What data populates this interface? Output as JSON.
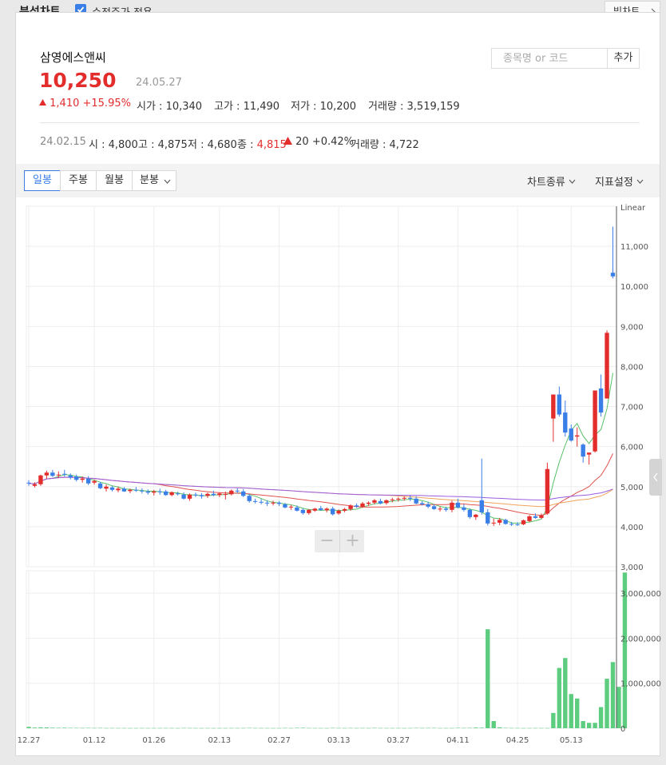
{
  "header": {
    "title": "분석차트",
    "adjusted_label": "수정주가 적용",
    "big_chart_label": "빅차트"
  },
  "stock": {
    "name": "삼영에스앤씨",
    "price": "10,250",
    "date": "24.05.27",
    "change": "1,410",
    "change_pct": "+15.95%",
    "open_label": "시가 : ",
    "open": "10,340",
    "high_label": "고가 : ",
    "high": "11,490",
    "low_label": "저가 : ",
    "low": "10,200",
    "volume_label": "거래량 : ",
    "volume": "3,519,159"
  },
  "search": {
    "placeholder": "종목명 or 코드",
    "add_label": "추가"
  },
  "hover": {
    "date": "24.02.15",
    "open_label": "시 : ",
    "open": "4,800",
    "high_label": "고 : ",
    "high": "4,875",
    "low_label": "저 : ",
    "low": "4,680",
    "close_label": "종 : ",
    "close": "4,815",
    "change": "20",
    "change_pct": "+0.42%",
    "volume_label": "거래량 : ",
    "volume": "4,722"
  },
  "toolbar": {
    "tabs": [
      "일봉",
      "주봉",
      "월봉",
      "분봉"
    ],
    "chart_type": "차트종류",
    "indicator": "지표설정"
  },
  "colors": {
    "up": "#e32d2d",
    "down": "#3a7ee8",
    "volume": "#5ccc7e",
    "ma5": "#58c168",
    "ma20": "#e0524d",
    "ma60": "#f0a35a",
    "ma120": "#9b5ce0"
  },
  "chart_data": {
    "type": "candlestick",
    "scale_label": "Linear",
    "price_ticks": [
      "3,000",
      "4,000",
      "5,000",
      "6,000",
      "7,000",
      "8,000",
      "9,000",
      "10,000",
      "11,000"
    ],
    "price_tick_values": [
      3000,
      4000,
      5000,
      6000,
      7000,
      8000,
      9000,
      10000,
      11000
    ],
    "price_range": [
      3000,
      12000
    ],
    "volume_ticks": [
      "0",
      "1,000,000",
      "2,000,000",
      "3,000,000"
    ],
    "volume_tick_values": [
      0,
      1000000,
      2000000,
      3000000
    ],
    "volume_range": [
      0,
      3500000
    ],
    "x_tick_labels": [
      "12.27",
      "01.12",
      "01.26",
      "02.13",
      "02.27",
      "03.13",
      "03.27",
      "04.11",
      "04.25",
      "05.13"
    ],
    "x_tick_index": [
      0,
      11,
      21,
      32,
      42,
      52,
      62,
      72,
      82,
      91
    ],
    "grid": true,
    "candles": [
      {
        "o": 5100,
        "h": 5160,
        "l": 5020,
        "c": 5080
      },
      {
        "o": 5020,
        "h": 5110,
        "l": 4980,
        "c": 5060
      },
      {
        "o": 5060,
        "h": 5300,
        "l": 5020,
        "c": 5280
      },
      {
        "o": 5280,
        "h": 5400,
        "l": 5200,
        "c": 5350
      },
      {
        "o": 5350,
        "h": 5420,
        "l": 5240,
        "c": 5270
      },
      {
        "o": 5280,
        "h": 5380,
        "l": 5220,
        "c": 5300
      },
      {
        "o": 5320,
        "h": 5420,
        "l": 5250,
        "c": 5300
      },
      {
        "o": 5280,
        "h": 5330,
        "l": 5180,
        "c": 5230
      },
      {
        "o": 5250,
        "h": 5300,
        "l": 5130,
        "c": 5170
      },
      {
        "o": 5170,
        "h": 5250,
        "l": 5100,
        "c": 5200
      },
      {
        "o": 5200,
        "h": 5260,
        "l": 5040,
        "c": 5080
      },
      {
        "o": 5100,
        "h": 5180,
        "l": 5050,
        "c": 5140
      },
      {
        "o": 5080,
        "h": 5120,
        "l": 4940,
        "c": 4960
      },
      {
        "o": 4950,
        "h": 5050,
        "l": 4880,
        "c": 5000
      },
      {
        "o": 4980,
        "h": 5020,
        "l": 4880,
        "c": 4920
      },
      {
        "o": 4910,
        "h": 5000,
        "l": 4860,
        "c": 4950
      },
      {
        "o": 4950,
        "h": 4990,
        "l": 4870,
        "c": 4880
      },
      {
        "o": 4890,
        "h": 4950,
        "l": 4840,
        "c": 4920
      },
      {
        "o": 4920,
        "h": 4990,
        "l": 4870,
        "c": 4900
      },
      {
        "o": 4900,
        "h": 4960,
        "l": 4830,
        "c": 4880
      },
      {
        "o": 4880,
        "h": 4930,
        "l": 4800,
        "c": 4850
      },
      {
        "o": 4850,
        "h": 4920,
        "l": 4780,
        "c": 4880
      },
      {
        "o": 4880,
        "h": 4950,
        "l": 4800,
        "c": 4870
      },
      {
        "o": 4880,
        "h": 4920,
        "l": 4770,
        "c": 4790
      },
      {
        "o": 4790,
        "h": 4880,
        "l": 4760,
        "c": 4860
      },
      {
        "o": 4830,
        "h": 4870,
        "l": 4780,
        "c": 4820
      },
      {
        "o": 4800,
        "h": 4860,
        "l": 4680,
        "c": 4700
      },
      {
        "o": 4700,
        "h": 4830,
        "l": 4650,
        "c": 4800
      },
      {
        "o": 4800,
        "h": 4850,
        "l": 4740,
        "c": 4790
      },
      {
        "o": 4790,
        "h": 4840,
        "l": 4700,
        "c": 4760
      },
      {
        "o": 4770,
        "h": 4850,
        "l": 4720,
        "c": 4820
      },
      {
        "o": 4820,
        "h": 4900,
        "l": 4760,
        "c": 4790
      },
      {
        "o": 4790,
        "h": 4850,
        "l": 4740,
        "c": 4830
      },
      {
        "o": 4800,
        "h": 4875,
        "l": 4680,
        "c": 4815
      },
      {
        "o": 4810,
        "h": 4930,
        "l": 4780,
        "c": 4900
      },
      {
        "o": 4900,
        "h": 4960,
        "l": 4840,
        "c": 4880
      },
      {
        "o": 4880,
        "h": 4940,
        "l": 4740,
        "c": 4770
      },
      {
        "o": 4770,
        "h": 4820,
        "l": 4600,
        "c": 4640
      },
      {
        "o": 4640,
        "h": 4700,
        "l": 4580,
        "c": 4620
      },
      {
        "o": 4620,
        "h": 4690,
        "l": 4560,
        "c": 4600
      },
      {
        "o": 4600,
        "h": 4660,
        "l": 4520,
        "c": 4580
      },
      {
        "o": 4580,
        "h": 4650,
        "l": 4530,
        "c": 4600
      },
      {
        "o": 4600,
        "h": 4640,
        "l": 4520,
        "c": 4570
      },
      {
        "o": 4560,
        "h": 4590,
        "l": 4460,
        "c": 4480
      },
      {
        "o": 4480,
        "h": 4540,
        "l": 4420,
        "c": 4500
      },
      {
        "o": 4480,
        "h": 4530,
        "l": 4380,
        "c": 4400
      },
      {
        "o": 4420,
        "h": 4460,
        "l": 4300,
        "c": 4340
      },
      {
        "o": 4340,
        "h": 4440,
        "l": 4300,
        "c": 4420
      },
      {
        "o": 4400,
        "h": 4470,
        "l": 4370,
        "c": 4450
      },
      {
        "o": 4460,
        "h": 4520,
        "l": 4400,
        "c": 4420
      },
      {
        "o": 4410,
        "h": 4480,
        "l": 4360,
        "c": 4450
      },
      {
        "o": 4450,
        "h": 4500,
        "l": 4280,
        "c": 4310
      },
      {
        "o": 4330,
        "h": 4430,
        "l": 4300,
        "c": 4400
      },
      {
        "o": 4400,
        "h": 4470,
        "l": 4360,
        "c": 4440
      },
      {
        "o": 4440,
        "h": 4560,
        "l": 4400,
        "c": 4530
      },
      {
        "o": 4530,
        "h": 4580,
        "l": 4470,
        "c": 4500
      },
      {
        "o": 4500,
        "h": 4620,
        "l": 4470,
        "c": 4580
      },
      {
        "o": 4570,
        "h": 4630,
        "l": 4520,
        "c": 4600
      },
      {
        "o": 4600,
        "h": 4690,
        "l": 4560,
        "c": 4660
      },
      {
        "o": 4640,
        "h": 4700,
        "l": 4560,
        "c": 4580
      },
      {
        "o": 4590,
        "h": 4680,
        "l": 4550,
        "c": 4660
      },
      {
        "o": 4660,
        "h": 4720,
        "l": 4610,
        "c": 4680
      },
      {
        "o": 4680,
        "h": 4740,
        "l": 4630,
        "c": 4700
      },
      {
        "o": 4700,
        "h": 4760,
        "l": 4650,
        "c": 4720
      },
      {
        "o": 4720,
        "h": 4780,
        "l": 4640,
        "c": 4700
      },
      {
        "o": 4700,
        "h": 4760,
        "l": 4560,
        "c": 4580
      },
      {
        "o": 4590,
        "h": 4640,
        "l": 4530,
        "c": 4560
      },
      {
        "o": 4560,
        "h": 4620,
        "l": 4460,
        "c": 4500
      },
      {
        "o": 4510,
        "h": 4560,
        "l": 4420,
        "c": 4440
      },
      {
        "o": 4440,
        "h": 4500,
        "l": 4380,
        "c": 4450
      },
      {
        "o": 4450,
        "h": 4500,
        "l": 4380,
        "c": 4420
      },
      {
        "o": 4420,
        "h": 4650,
        "l": 4360,
        "c": 4600
      },
      {
        "o": 4600,
        "h": 4700,
        "l": 4460,
        "c": 4480
      },
      {
        "o": 4480,
        "h": 4560,
        "l": 4380,
        "c": 4420
      },
      {
        "o": 4420,
        "h": 4460,
        "l": 4200,
        "c": 4240
      },
      {
        "o": 4240,
        "h": 4320,
        "l": 4170,
        "c": 4300
      },
      {
        "o": 4660,
        "h": 5700,
        "l": 4300,
        "c": 4360
      },
      {
        "o": 4360,
        "h": 4440,
        "l": 4030,
        "c": 4080
      },
      {
        "o": 4080,
        "h": 4200,
        "l": 4020,
        "c": 4100
      },
      {
        "o": 4100,
        "h": 4220,
        "l": 4040,
        "c": 4170
      },
      {
        "o": 4170,
        "h": 4200,
        "l": 4050,
        "c": 4070
      },
      {
        "o": 4070,
        "h": 4120,
        "l": 4020,
        "c": 4060
      },
      {
        "o": 4060,
        "h": 4110,
        "l": 4020,
        "c": 4040
      },
      {
        "o": 4060,
        "h": 4180,
        "l": 4040,
        "c": 4160
      },
      {
        "o": 4140,
        "h": 4290,
        "l": 4110,
        "c": 4260
      },
      {
        "o": 4260,
        "h": 4330,
        "l": 4200,
        "c": 4220
      },
      {
        "o": 4220,
        "h": 4330,
        "l": 4200,
        "c": 4280
      },
      {
        "o": 4330,
        "h": 5600,
        "l": 4300,
        "c": 5440
      },
      {
        "o": 6700,
        "h": 7300,
        "l": 6120,
        "c": 7300
      },
      {
        "o": 7300,
        "h": 7500,
        "l": 6750,
        "c": 6800
      },
      {
        "o": 6850,
        "h": 7150,
        "l": 6250,
        "c": 6350
      },
      {
        "o": 6450,
        "h": 6550,
        "l": 6120,
        "c": 6150
      },
      {
        "o": 6250,
        "h": 6480,
        "l": 6000,
        "c": 6280
      },
      {
        "o": 6050,
        "h": 6080,
        "l": 5600,
        "c": 5750
      },
      {
        "o": 5800,
        "h": 5850,
        "l": 5550,
        "c": 5850
      },
      {
        "o": 5880,
        "h": 7400,
        "l": 5850,
        "c": 7400
      },
      {
        "o": 7450,
        "h": 7800,
        "l": 6750,
        "c": 6850
      },
      {
        "o": 7200,
        "h": 8900,
        "l": 7200,
        "c": 8840
      },
      {
        "o": 10340,
        "h": 11490,
        "l": 10200,
        "c": 10250
      }
    ],
    "volume": [
      30000,
      15000,
      20000,
      18000,
      12000,
      10000,
      12000,
      9000,
      8000,
      7000,
      9000,
      6000,
      8000,
      5000,
      6000,
      5000,
      5000,
      4000,
      4722,
      5000,
      5000,
      4000,
      5000,
      6000,
      5000,
      4000,
      7000,
      6000,
      5000,
      4000,
      5000,
      4000,
      4000,
      4722,
      6000,
      5000,
      6000,
      8000,
      6000,
      5000,
      5000,
      4000,
      4000,
      7000,
      5000,
      9000,
      10000,
      6000,
      5000,
      5000,
      4000,
      8000,
      6000,
      5000,
      7000,
      5000,
      6000,
      5000,
      8000,
      6000,
      5000,
      5000,
      5000,
      4000,
      5000,
      8000,
      6000,
      7000,
      8000,
      5000,
      5000,
      5000,
      9000,
      7000,
      8000,
      15000,
      12000,
      2200000,
      160000,
      20000,
      9000,
      6000,
      5000,
      4000,
      5000,
      6000,
      5000,
      5000,
      340000,
      1340000,
      1560000,
      760000,
      660000,
      160000,
      120000,
      120000,
      470000,
      1100000,
      1470000,
      920000,
      3460000
    ]
  }
}
